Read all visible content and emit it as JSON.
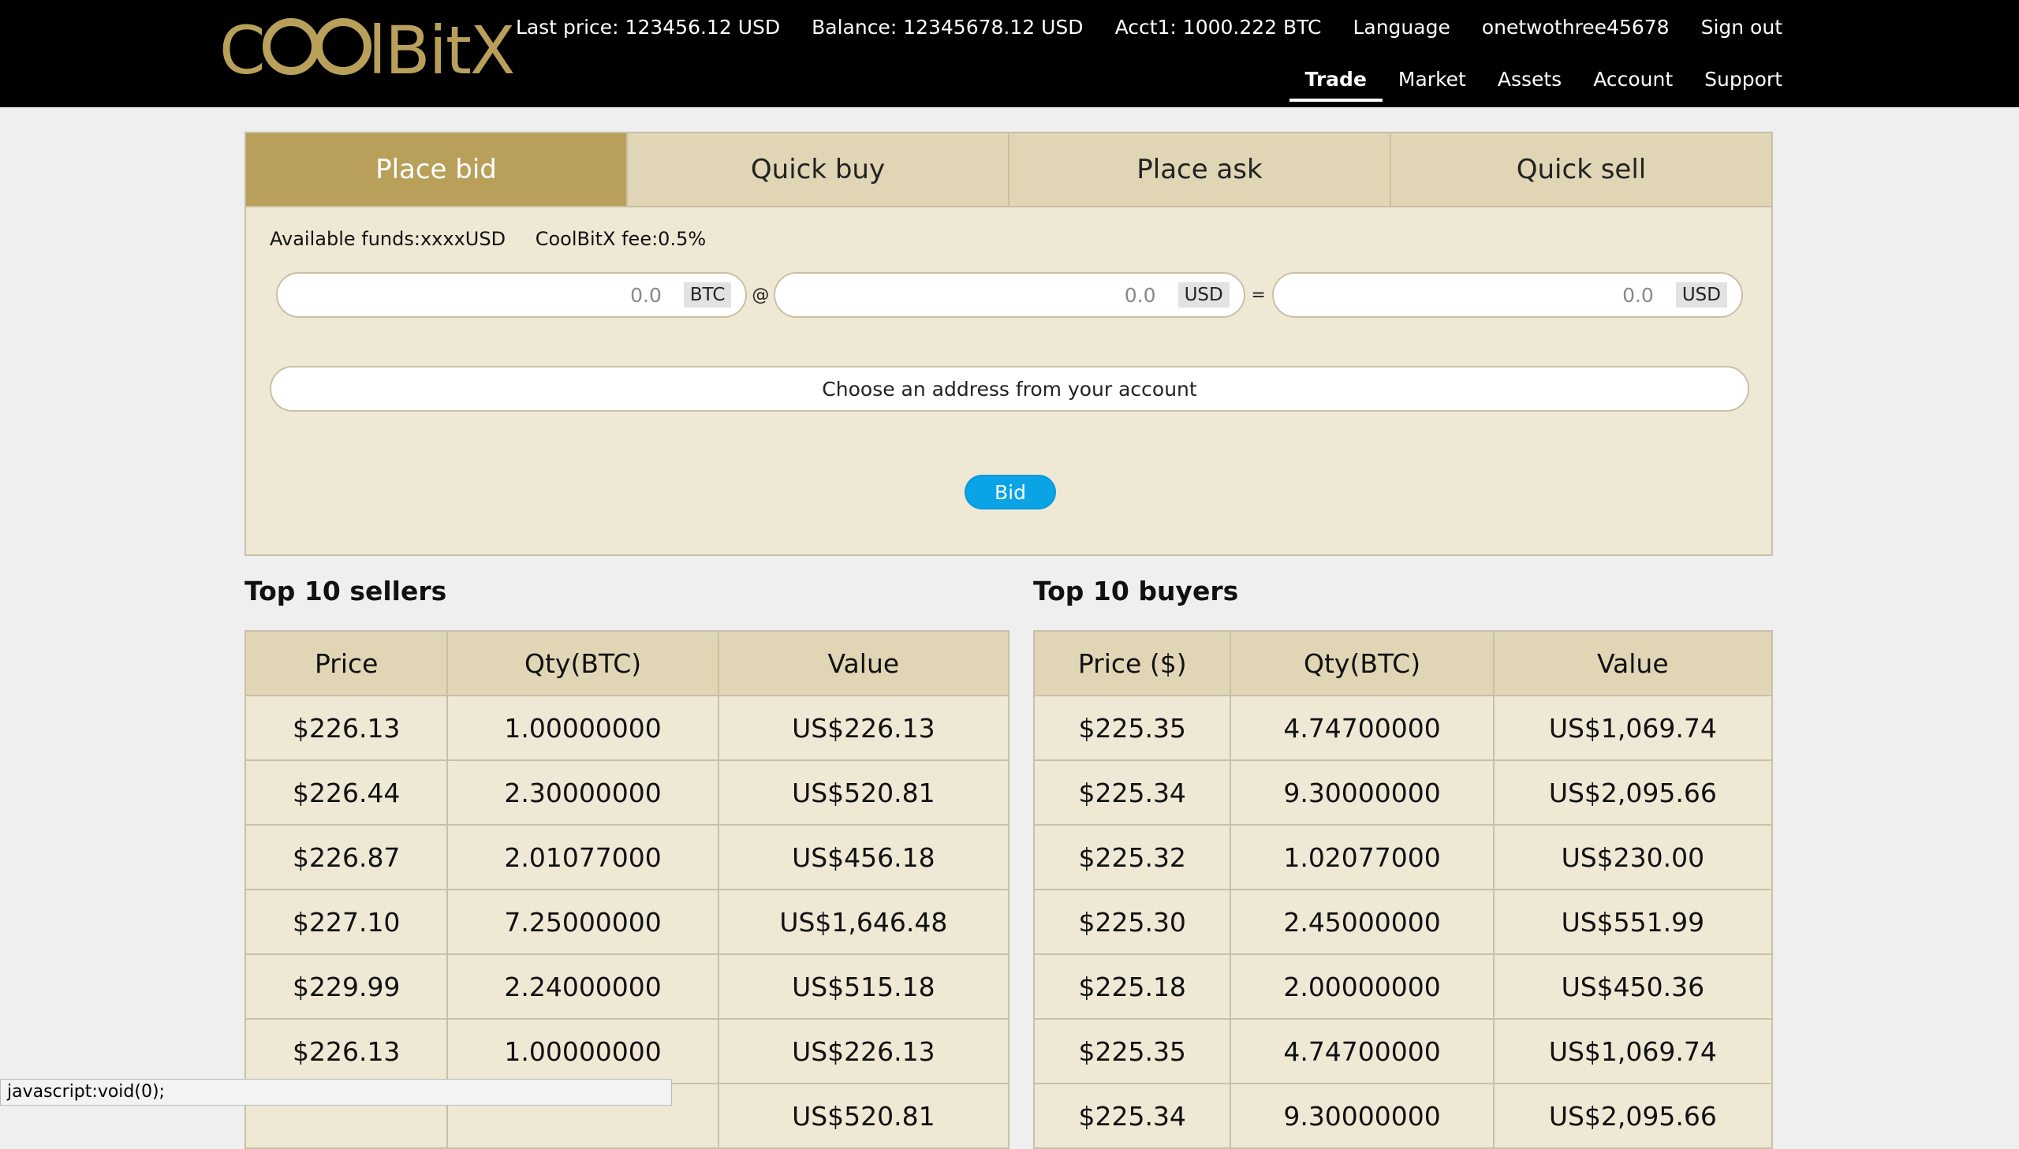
{
  "brand": {
    "logo_text": "CoolBitX"
  },
  "header": {
    "last_price": "Last price: 123456.12 USD",
    "balance": "Balance: 12345678.12 USD",
    "account_balance": "Acct1: 1000.222 BTC",
    "language": "Language",
    "username": "onetwothree45678",
    "sign_out": "Sign out"
  },
  "nav": [
    {
      "label": "Trade",
      "active": true
    },
    {
      "label": "Market"
    },
    {
      "label": "Assets"
    },
    {
      "label": "Account"
    },
    {
      "label": "Support"
    }
  ],
  "tabs": [
    {
      "label": "Place bid",
      "active": true
    },
    {
      "label": "Quick buy"
    },
    {
      "label": "Place ask"
    },
    {
      "label": "Quick sell"
    }
  ],
  "order_form": {
    "available_funds": "Available funds:xxxxUSD",
    "fee": "CoolBitX fee:0.5%",
    "quantity": {
      "value": "0.0",
      "unit": "BTC"
    },
    "at_symbol": "@",
    "price": {
      "value": "0.0",
      "unit": "USD"
    },
    "equals_symbol": "=",
    "total": {
      "value": "0.0",
      "unit": "USD"
    },
    "address_placeholder": "Choose an address from your account",
    "submit_label": "Bid"
  },
  "sellers": {
    "title": "Top 10 sellers",
    "columns": [
      "Price",
      "Qty(BTC)",
      "Value"
    ],
    "rows": [
      [
        "$226.13",
        "1.00000000",
        "US$226.13"
      ],
      [
        "$226.44",
        "2.30000000",
        "US$520.81"
      ],
      [
        "$226.87",
        "2.01077000",
        "US$456.18"
      ],
      [
        "$227.10",
        "7.25000000",
        "US$1,646.48"
      ],
      [
        "$229.99",
        "2.24000000",
        "US$515.18"
      ],
      [
        "$226.13",
        "1.00000000",
        "US$226.13"
      ],
      [
        "",
        "",
        "US$520.81"
      ]
    ]
  },
  "buyers": {
    "title": "Top 10 buyers",
    "columns": [
      "Price ($)",
      "Qty(BTC)",
      "Value"
    ],
    "rows": [
      [
        "$225.35",
        "4.74700000",
        "US$1,069.74"
      ],
      [
        "$225.34",
        "9.30000000",
        "US$2,095.66"
      ],
      [
        "$225.32",
        "1.02077000",
        "US$230.00"
      ],
      [
        "$225.30",
        "2.45000000",
        "US$551.99"
      ],
      [
        "$225.18",
        "2.00000000",
        "US$450.36"
      ],
      [
        "$225.35",
        "4.74700000",
        "US$1,069.74"
      ],
      [
        "$225.34",
        "9.30000000",
        "US$2,095.66"
      ]
    ]
  },
  "status_bar": "javascript:void(0);"
}
